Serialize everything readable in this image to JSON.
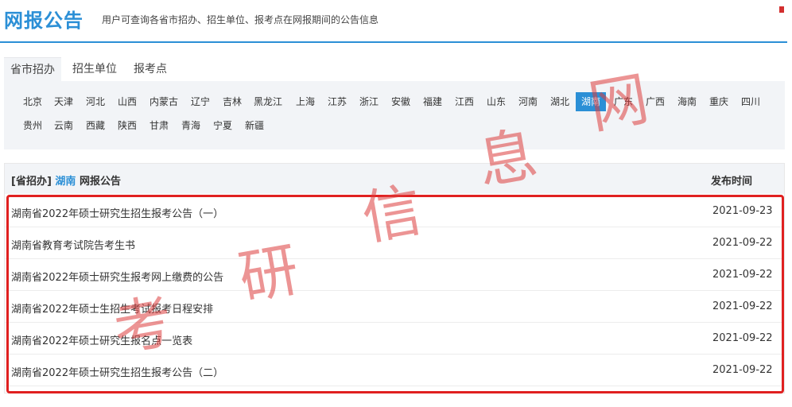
{
  "header": {
    "title": "网报公告",
    "subtitle": "用户可查询各省市招办、招生单位、报考点在网报期间的公告信息"
  },
  "tabs": [
    {
      "label": "省市招办",
      "active": true
    },
    {
      "label": "招生单位",
      "active": false
    },
    {
      "label": "报考点",
      "active": false
    }
  ],
  "provinces": [
    "北京",
    "天津",
    "河北",
    "山西",
    "内蒙古",
    "辽宁",
    "吉林",
    "黑龙江",
    "上海",
    "江苏",
    "浙江",
    "安徽",
    "福建",
    "江西",
    "山东",
    "河南",
    "湖北",
    "湖南",
    "广东",
    "广西",
    "海南",
    "重庆",
    "四川",
    "贵州",
    "云南",
    "西藏",
    "陕西",
    "甘肃",
    "青海",
    "宁夏",
    "新疆"
  ],
  "selected_province": "湖南",
  "table": {
    "head_prefix": "[省招办]",
    "head_province": "湖南",
    "head_suffix": "网报公告",
    "date_header": "发布时间",
    "rows": [
      {
        "title": "湖南省2022年硕士研究生招生报考公告（一）",
        "date": "2021-09-23"
      },
      {
        "title": "湖南省教育考试院告考生书",
        "date": "2021-09-22"
      },
      {
        "title": "湖南省2022年硕士研究生报考网上缴费的公告",
        "date": "2021-09-22"
      },
      {
        "title": "湖南省2022年硕士生招生考试报考日程安排",
        "date": "2021-09-22"
      },
      {
        "title": "湖南省2022年硕士研究生报名点一览表",
        "date": "2021-09-22"
      },
      {
        "title": "湖南省2022年硕士研究生招生报考公告（二）",
        "date": "2021-09-22"
      }
    ]
  },
  "watermark": {
    "chars": [
      "考",
      "研",
      "信",
      "息",
      "网"
    ]
  },
  "colors": {
    "accent": "#2b8fd6",
    "highlight_box": "#e02020",
    "panel_bg": "#f2f4f7"
  }
}
